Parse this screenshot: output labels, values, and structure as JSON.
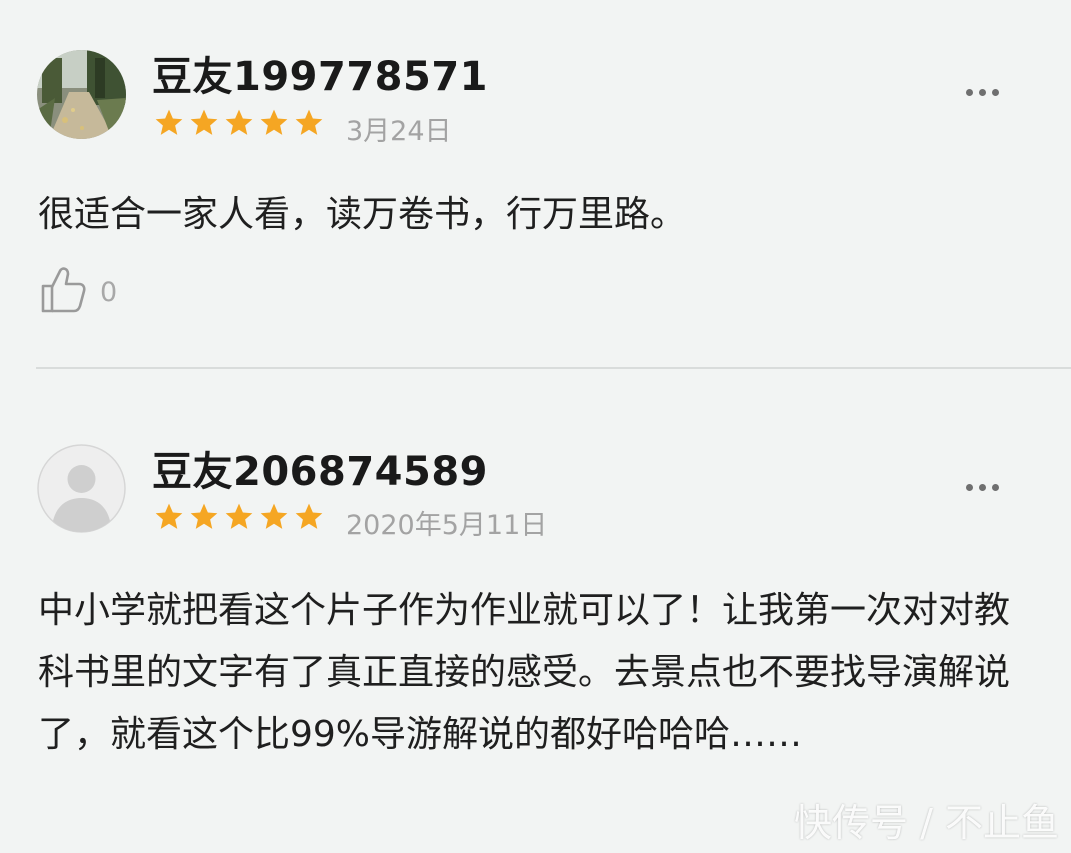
{
  "reviews": [
    {
      "username": "豆友199778571",
      "rating": 5,
      "date": "3月24日",
      "content": "很适合一家人看，读万卷书，行万里路。",
      "likes": "0",
      "avatar": "photo-avatar"
    },
    {
      "username": "豆友206874589",
      "rating": 5,
      "date": "2020年5月11日",
      "content": "中小学就把看这个片子作为作业就可以了！让我第一次对对教科书里的文字有了真正直接的感受。去景点也不要找导演解说了，就看这个比99%导游解说的都好哈哈哈……",
      "avatar": "default-avatar"
    }
  ],
  "watermark": "快传号 / 不止鱼",
  "colors": {
    "background": "#f2f4f3",
    "star": "#f5a623",
    "date": "#a3a3a3",
    "divider": "#d9dcdb"
  },
  "icons": {
    "more": "more-dots-icon",
    "like": "thumbs-up-icon",
    "star": "star-icon"
  }
}
